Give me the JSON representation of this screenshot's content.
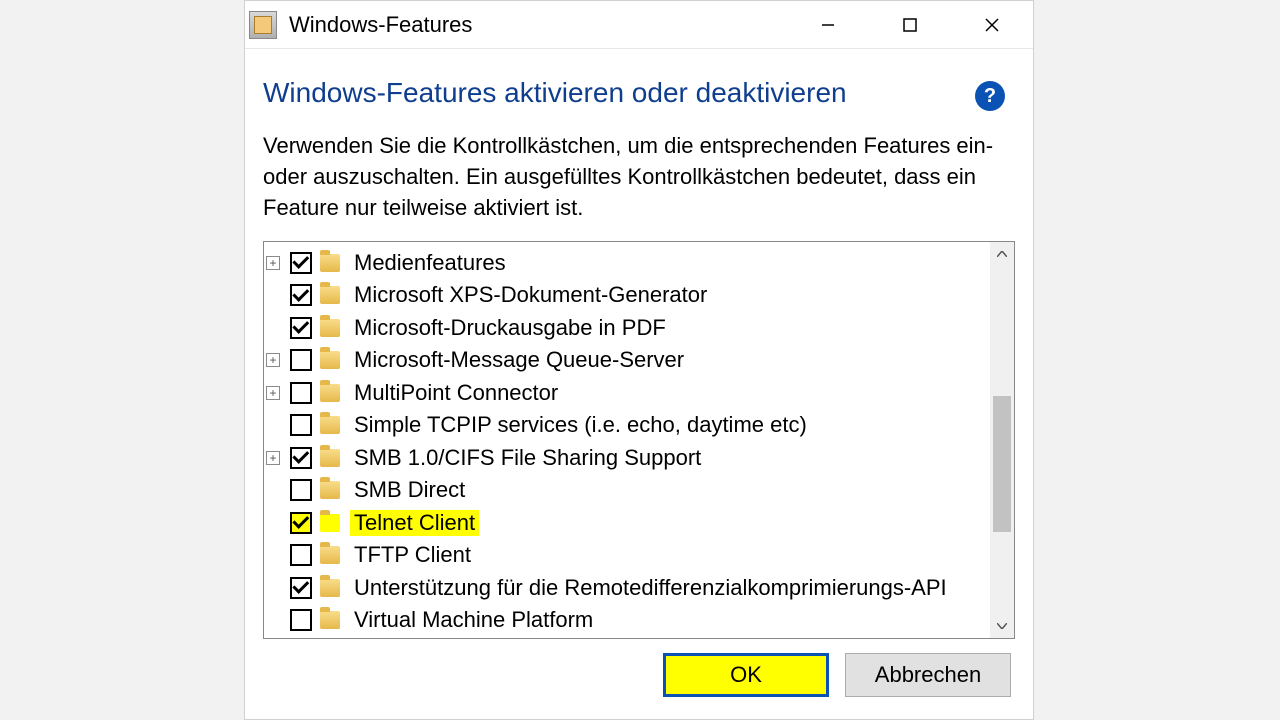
{
  "window": {
    "title": "Windows-Features"
  },
  "header": {
    "heading": "Windows-Features aktivieren oder deaktivieren",
    "description": "Verwenden Sie die Kontrollkästchen, um die entsprechenden Features ein- oder auszuschalten. Ein ausgefülltes Kontrollkästchen bedeutet, dass ein Feature nur teilweise aktiviert ist."
  },
  "tree": {
    "items": [
      {
        "label": "Medienfeatures",
        "checked": true,
        "expandable": true
      },
      {
        "label": "Microsoft XPS-Dokument-Generator",
        "checked": true,
        "expandable": false
      },
      {
        "label": "Microsoft-Druckausgabe in PDF",
        "checked": true,
        "expandable": false
      },
      {
        "label": "Microsoft-Message Queue-Server",
        "checked": false,
        "expandable": true
      },
      {
        "label": "MultiPoint Connector",
        "checked": false,
        "expandable": true
      },
      {
        "label": "Simple TCPIP services (i.e. echo, daytime etc)",
        "checked": false,
        "expandable": false
      },
      {
        "label": "SMB 1.0/CIFS File Sharing Support",
        "checked": true,
        "expandable": true
      },
      {
        "label": "SMB Direct",
        "checked": false,
        "expandable": false
      },
      {
        "label": "Telnet Client",
        "checked": true,
        "expandable": false,
        "highlighted": true
      },
      {
        "label": "TFTP Client",
        "checked": false,
        "expandable": false
      },
      {
        "label": "Unterstützung für die Remotedifferenzialkomprimierungs-API",
        "checked": true,
        "expandable": false
      },
      {
        "label": "Virtual Machine Platform",
        "checked": false,
        "expandable": false
      }
    ]
  },
  "buttons": {
    "ok": "OK",
    "cancel": "Abbrechen"
  }
}
